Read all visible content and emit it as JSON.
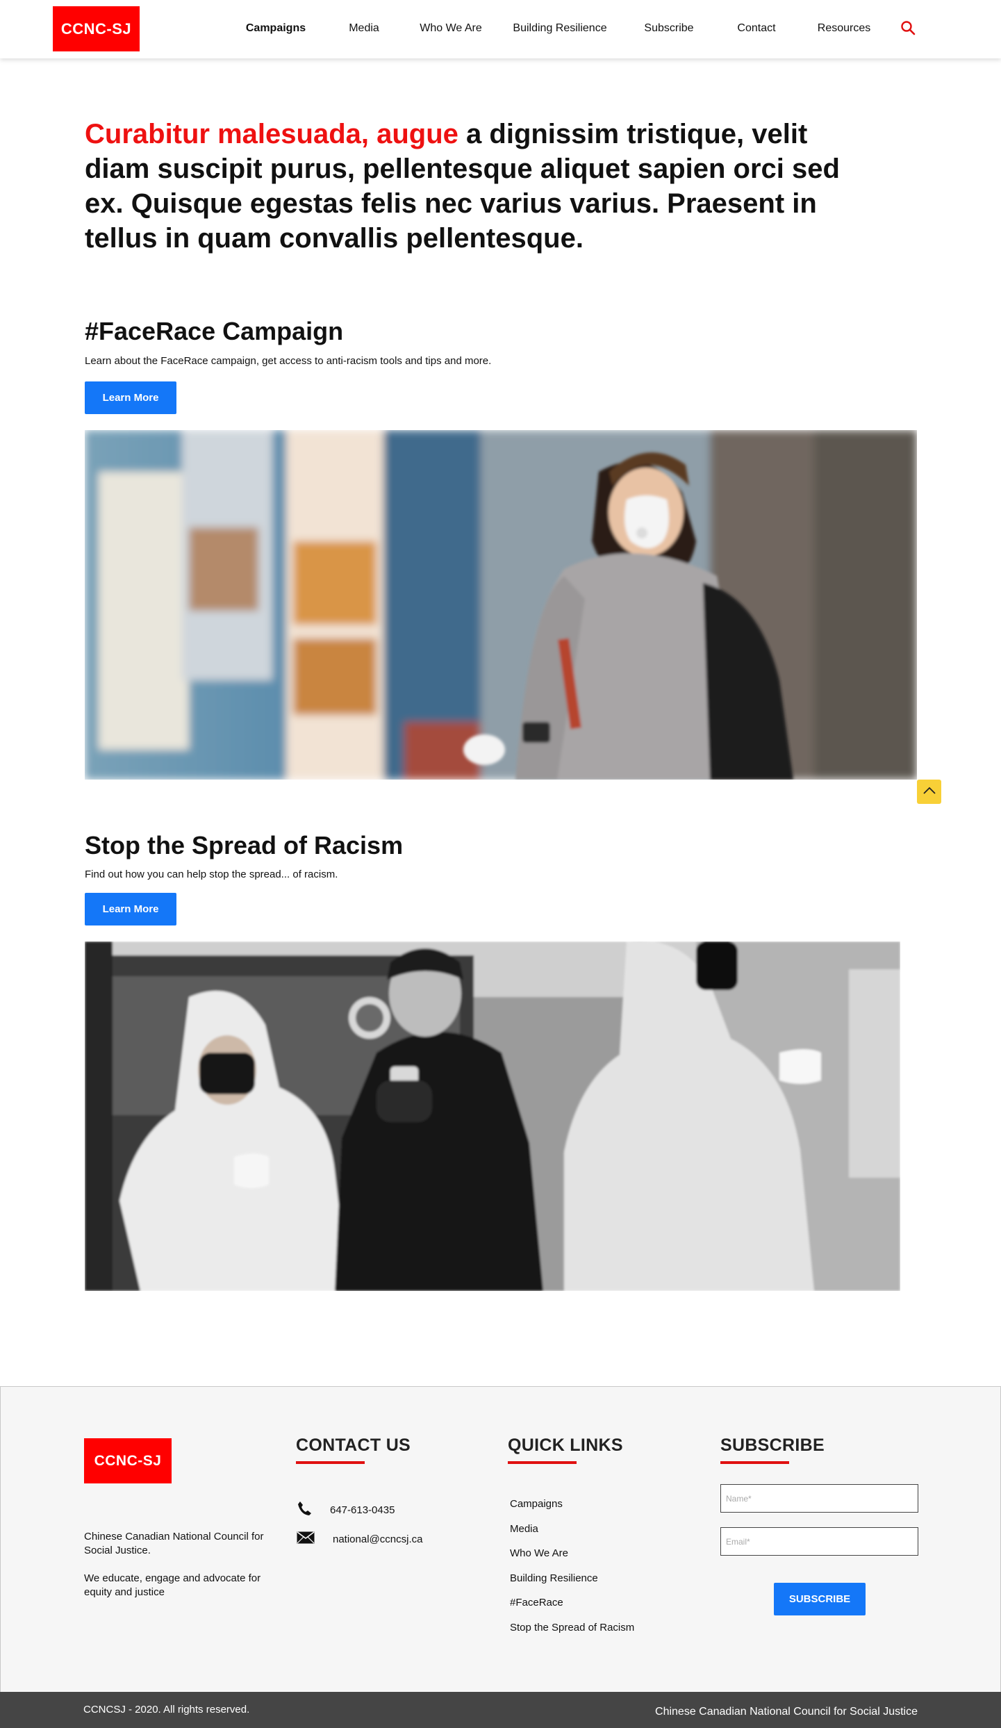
{
  "brand": {
    "logo_text": "CCNC-SJ",
    "color": "#ff0000",
    "accent_blue": "#1477f8"
  },
  "nav": {
    "items": [
      {
        "label": "Campaigns",
        "active": true
      },
      {
        "label": "Media"
      },
      {
        "label": "Who We Are"
      },
      {
        "label": "Building Resilience"
      },
      {
        "label": "Subscribe"
      },
      {
        "label": "Contact"
      },
      {
        "label": "Resources"
      }
    ],
    "search_icon": "search-icon"
  },
  "hero": {
    "accent_text": "Curabitur malesuada, augue",
    "rest_text": " a dignissim tristique, velit diam suscipit purus, pellentesque aliquet sapien orci sed ex. Quisque egestas felis nec varius varius. Praesent in tellus in quam convallis pellentesque."
  },
  "sections": [
    {
      "title": "#FaceRace Campaign",
      "description": "Learn about the FaceRace campaign, get access to anti-racism tools and tips and more.",
      "button_label": "Learn More"
    },
    {
      "title": "Stop the Spread of Racism",
      "description": "Find out how you can help stop the spread... of racism.",
      "button_label": "Learn More"
    }
  ],
  "scroll_top_icon": "chevron-up-icon",
  "footer": {
    "logo_text": "CCNC-SJ",
    "org_name": "Chinese Canadian National Council for Social Justice.",
    "mission": "We educate, engage and advocate for equity and justice",
    "contact": {
      "title": "CONTACT US",
      "phone": "647-613-0435",
      "email": "national@ccncsj.ca"
    },
    "quick_links": {
      "title": "QUICK LINKS",
      "items": [
        "Campaigns",
        "Media",
        "Who We Are",
        "Building Resilience",
        "#FaceRace",
        "Stop the Spread of Racism"
      ]
    },
    "subscribe": {
      "title": "SUBSCRIBE",
      "name_placeholder": "Name*",
      "email_placeholder": "Email*",
      "button_label": "SUBSCRIBE"
    }
  },
  "bottom_bar": {
    "copyright": "CCNCSJ - 2020. All rights reserved.",
    "org_full": "Chinese Canadian National Council for Social Justice"
  }
}
